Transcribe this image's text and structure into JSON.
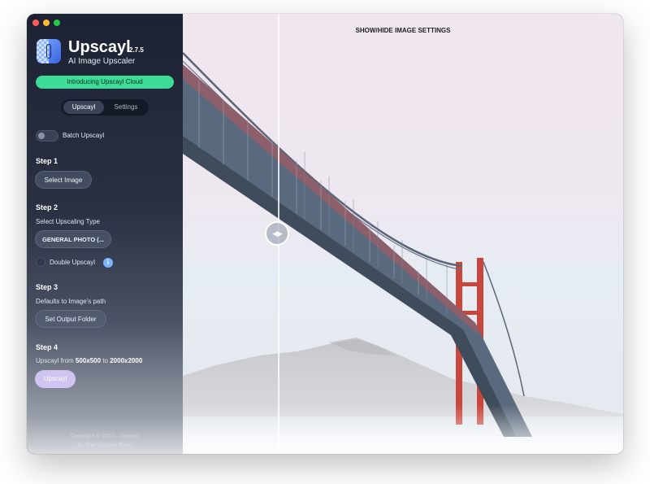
{
  "app": {
    "name": "Upscayl",
    "version": "2.7.5",
    "subtitle": "AI Image Upscaler"
  },
  "cloud_button": "Introducing Upscayl Cloud",
  "tabs": [
    "Upscayl",
    "Settings"
  ],
  "batch_label": "Batch Upscayl",
  "steps": {
    "step1": {
      "title": "Step 1",
      "button": "Select Image"
    },
    "step2": {
      "title": "Step 2",
      "description": "Select Upscaling Type",
      "model": "GENERAL PHOTO (...",
      "double_label": "Double Upscayl",
      "info_icon_text": "i"
    },
    "step3": {
      "title": "Step 3",
      "description": "Defaults to Image's path",
      "button": "Set Output Folder"
    },
    "step4": {
      "title": "Step 4",
      "prefix": "Upscayl from",
      "from_res": "500x500",
      "to_word": "to",
      "to_res": "2000x2000",
      "button": "Upscayl"
    }
  },
  "footer": {
    "line1": "Copyright © 2024 · Upscayl",
    "line2": "By The Upscayl Team"
  },
  "viewer": {
    "settings_link": "SHOW/HIDE IMAGE SETTINGS",
    "slider_handle_glyph": "◀▶"
  },
  "colors": {
    "accent_green": "#3ddc97",
    "sidebar_dark": "#1c2233",
    "upscayl_button": "#cfc5f0",
    "info_blue": "#7bb3ff"
  },
  "icons": [
    "upscayl-logo-icon",
    "info-icon",
    "compare-slider-handle-icon"
  ]
}
